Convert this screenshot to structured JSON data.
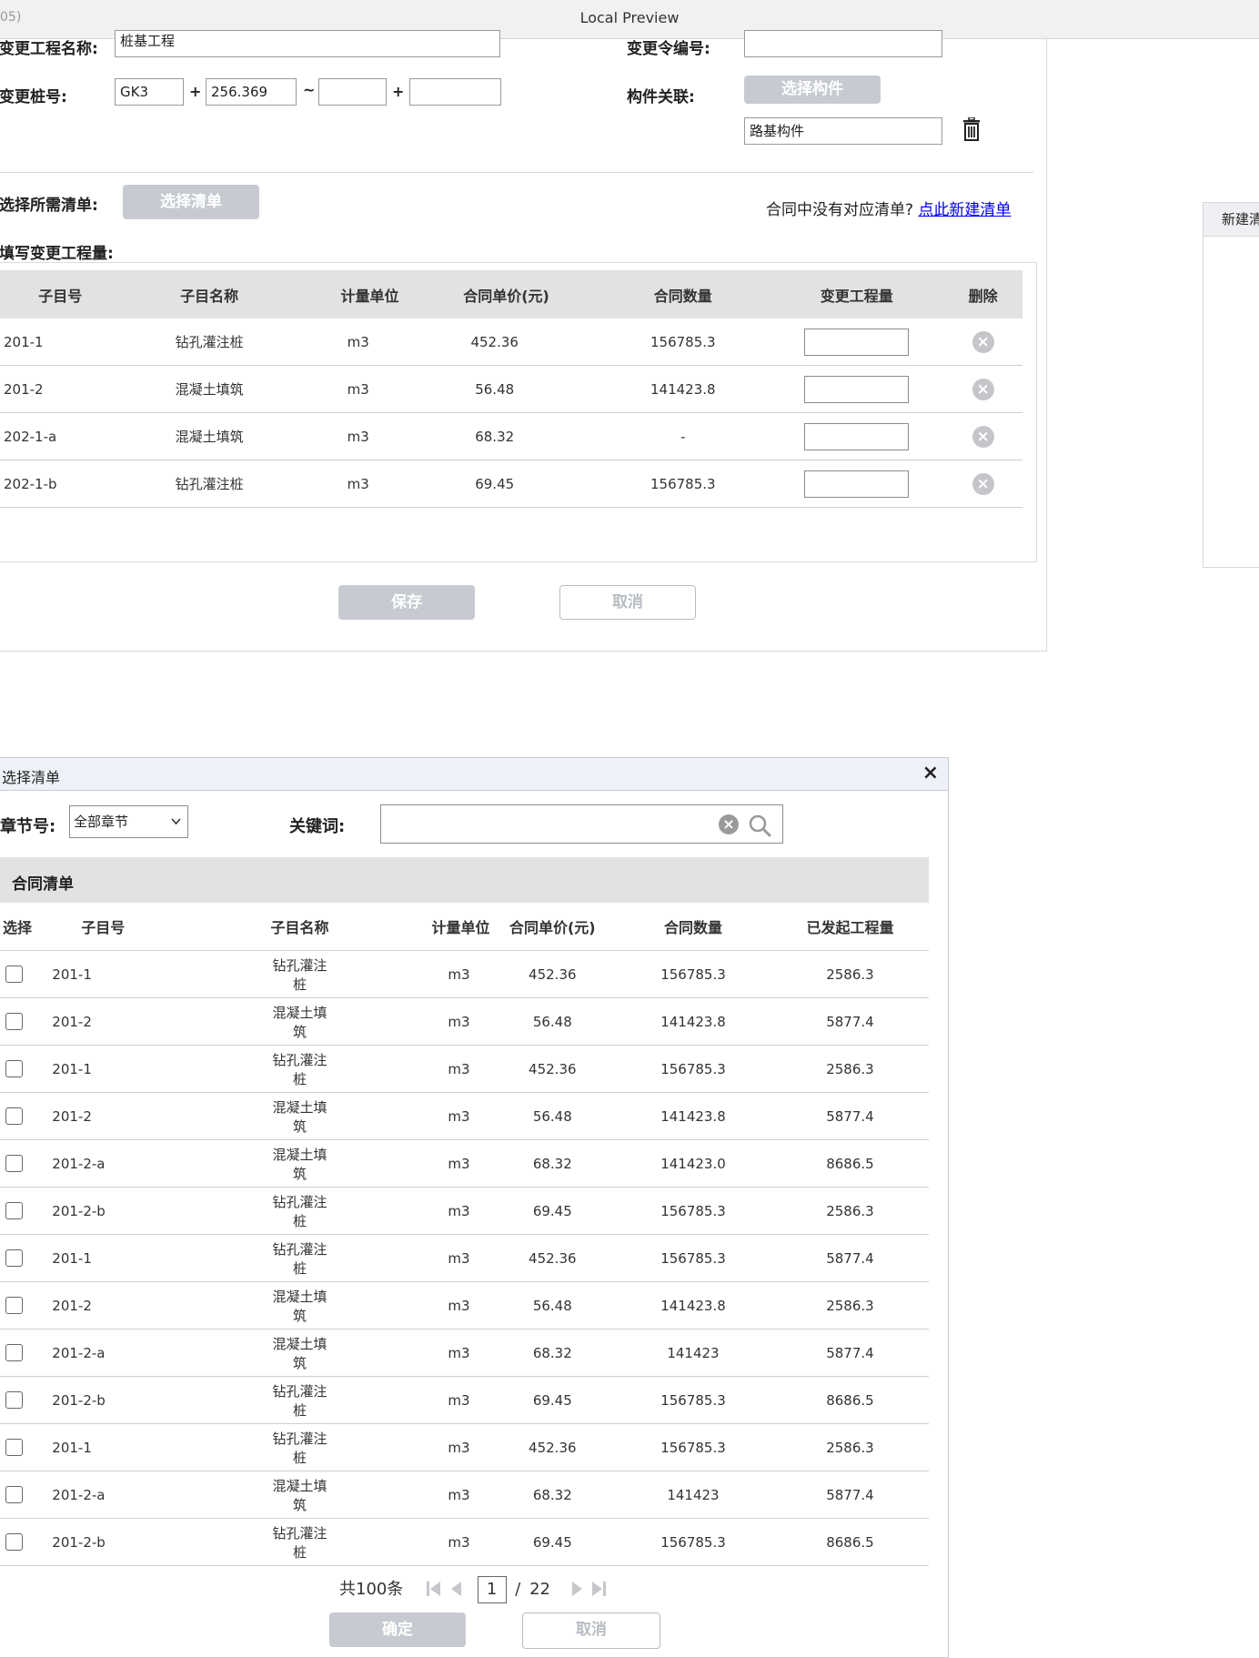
{
  "window": {
    "title": "Local Preview",
    "left_fragment": "05)"
  },
  "form": {
    "name_label": "变更工程名称:",
    "name_value": "桩基工程",
    "order_no_label": "变更令编号:",
    "order_no_value": "",
    "station_label": "变更桩号:",
    "station_1": "GK3",
    "station_2": "256.369",
    "station_3": "",
    "station_4": "",
    "plus": "+",
    "tilde": "~",
    "component_label": "构件关联:",
    "component_btn": "选择构件",
    "component_value": "路基构件",
    "select_list_label": "选择所需清单:",
    "select_list_btn": "选择清单",
    "no_list_text": "合同中没有对应清单?",
    "new_list_link": "点此新建清单",
    "fill_qty_label": "填写变更工程量:",
    "save_btn": "保存",
    "cancel_btn": "取消"
  },
  "top_table": {
    "headers": [
      "子目号",
      "子目名称",
      "计量单位",
      "合同单价(元)",
      "合同数量",
      "变更工程量",
      "删除"
    ],
    "rows": [
      [
        "201-1",
        "钻孔灌注桩",
        "m3",
        "452.36",
        "156785.3"
      ],
      [
        "201-2",
        "混凝土填筑",
        "m3",
        "56.48",
        "141423.8"
      ],
      [
        "202-1-a",
        "混凝土填筑",
        "m3",
        "68.32",
        "-"
      ],
      [
        "202-1-b",
        "钻孔灌注桩",
        "m3",
        "69.45",
        "156785.3"
      ]
    ]
  },
  "side_panel": {
    "title": "新建清"
  },
  "dialog": {
    "title": "选择清单",
    "close": "×",
    "chapter_label": "章节号:",
    "chapter_selected": "全部章节",
    "keyword_label": "关键词:",
    "keyword_value": "",
    "section_title": "合同清单",
    "headers": [
      "选择",
      "子目号",
      "子目名称",
      "计量单位",
      "合同单价(元)",
      "合同数量",
      "已发起工程量"
    ],
    "rows": [
      [
        "201-1",
        "钻孔灌注桩",
        "m3",
        "452.36",
        "156785.3",
        "2586.3"
      ],
      [
        "201-2",
        "混凝土填筑",
        "m3",
        "56.48",
        "141423.8",
        "5877.4"
      ],
      [
        "201-1",
        "钻孔灌注桩",
        "m3",
        "452.36",
        "156785.3",
        "2586.3"
      ],
      [
        "201-2",
        "混凝土填筑",
        "m3",
        "56.48",
        "141423.8",
        "5877.4"
      ],
      [
        "201-2-a",
        "混凝土填筑",
        "m3",
        "68.32",
        "141423.0",
        "8686.5"
      ],
      [
        "201-2-b",
        "钻孔灌注桩",
        "m3",
        "69.45",
        "156785.3",
        "2586.3"
      ],
      [
        "201-1",
        "钻孔灌注桩",
        "m3",
        "452.36",
        "156785.3",
        "5877.4"
      ],
      [
        "201-2",
        "混凝土填筑",
        "m3",
        "56.48",
        "141423.8",
        "2586.3"
      ],
      [
        "201-2-a",
        "混凝土填筑",
        "m3",
        "68.32",
        "141423",
        "5877.4"
      ],
      [
        "201-2-b",
        "钻孔灌注桩",
        "m3",
        "69.45",
        "156785.3",
        "8686.5"
      ],
      [
        "201-1",
        "钻孔灌注桩",
        "m3",
        "452.36",
        "156785.3",
        "2586.3"
      ],
      [
        "201-2-a",
        "混凝土填筑",
        "m3",
        "68.32",
        "141423",
        "5877.4"
      ],
      [
        "201-2-b",
        "钻孔灌注桩",
        "m3",
        "69.45",
        "156785.3",
        "8686.5"
      ]
    ],
    "pagination": {
      "total": "共100条",
      "current_page": "1",
      "slash": "/",
      "total_pages": "22"
    },
    "confirm_btn": "确定",
    "cancel_btn": "取消"
  },
  "colors": {
    "button_gray": "#c7cbd1",
    "header_gray": "#e1e2e3",
    "link_blue": "#0000ee",
    "dialog_header": "#eef1f7"
  }
}
